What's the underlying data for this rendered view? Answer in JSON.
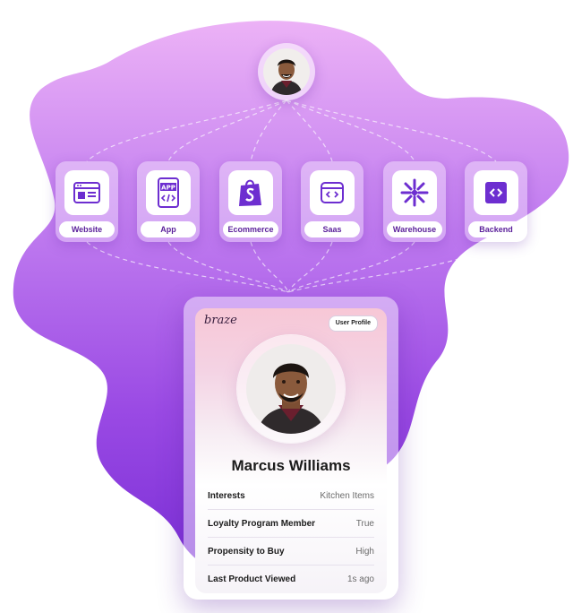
{
  "sources": [
    {
      "label": "Website",
      "icon": "website-icon"
    },
    {
      "label": "App",
      "icon": "app-icon",
      "glyph": "APP"
    },
    {
      "label": "Ecommerce",
      "icon": "shopify-icon"
    },
    {
      "label": "Saas",
      "icon": "saas-icon"
    },
    {
      "label": "Warehouse",
      "icon": "snowflake-icon"
    },
    {
      "label": "Backend",
      "icon": "code-icon"
    }
  ],
  "profile": {
    "brand": "braze",
    "badge": "User Profile",
    "name": "Marcus Williams",
    "attributes": [
      {
        "label": "Interests",
        "value": "Kitchen Items"
      },
      {
        "label": "Loyalty Program Member",
        "value": "True"
      },
      {
        "label": "Propensity to Buy",
        "value": "High"
      },
      {
        "label": "Last Product Viewed",
        "value": "1s ago"
      }
    ]
  },
  "colors": {
    "blob_top": "#e8a8f4",
    "blob_mid": "#b86cec",
    "blob_bottom": "#7a2ed6",
    "icon_purple": "#6d2ed0",
    "label_purple": "#5a1f9a"
  }
}
